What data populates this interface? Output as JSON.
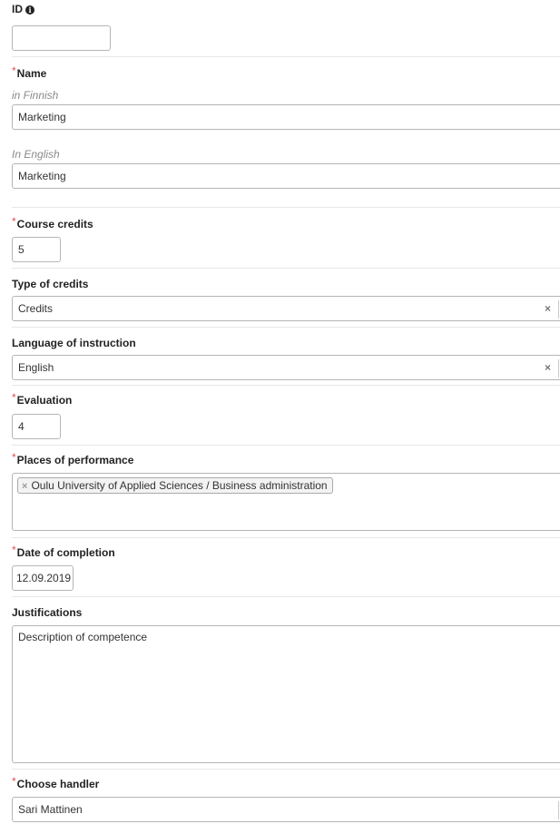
{
  "id_field": {
    "label": "ID",
    "value": ""
  },
  "name": {
    "label": "Name",
    "finnish_label": "in Finnish",
    "finnish_value": "Marketing",
    "english_label": "In English",
    "english_value": "Marketing"
  },
  "course_credits": {
    "label": "Course credits",
    "value": "5"
  },
  "type_of_credits": {
    "label": "Type of credits",
    "value": "Credits",
    "clear": "×"
  },
  "language": {
    "label": "Language of instruction",
    "value": "English",
    "clear": "×"
  },
  "evaluation": {
    "label": "Evaluation",
    "value": "4"
  },
  "places": {
    "label": "Places of performance",
    "tags": [
      "Oulu University of Applied Sciences / Business administration"
    ],
    "tag_remove": "×"
  },
  "date_of_completion": {
    "label": "Date of completion",
    "value": "12.09.2019"
  },
  "justifications": {
    "label": "Justifications",
    "value": "Description of competence"
  },
  "handler": {
    "label": "Choose handler",
    "value": "Sari Mattinen"
  },
  "required_marker": "*",
  "colors": {
    "required": "#d9534f",
    "border": "#b5b5b5",
    "divider": "#e7e7e7"
  }
}
